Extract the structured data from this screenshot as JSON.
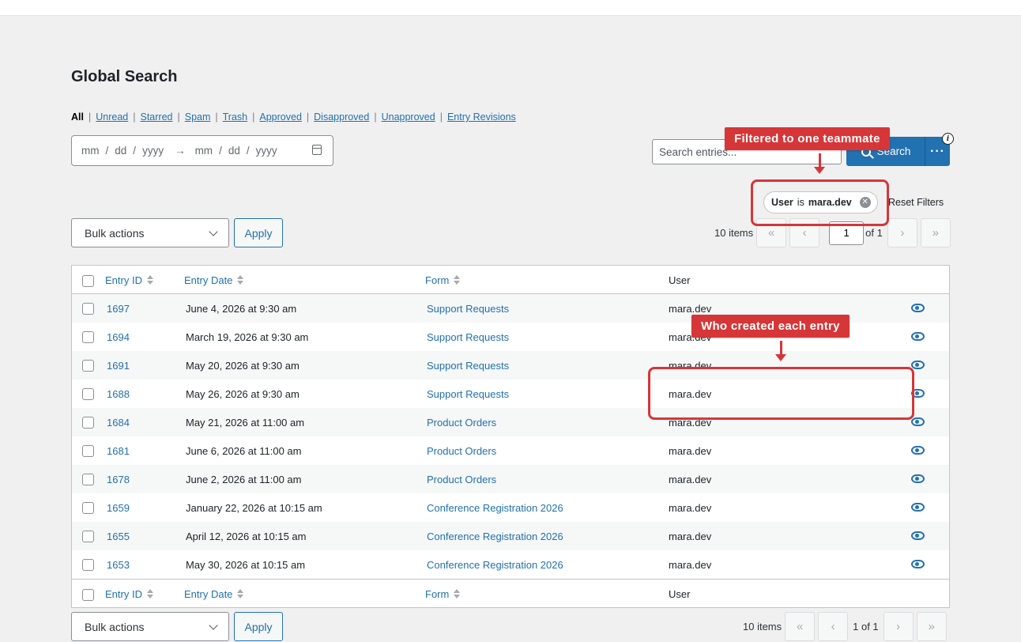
{
  "page": {
    "title": "Global Search"
  },
  "status_links": [
    {
      "label": "All",
      "current": true
    },
    {
      "label": "Unread"
    },
    {
      "label": "Starred"
    },
    {
      "label": "Spam"
    },
    {
      "label": "Trash"
    },
    {
      "label": "Approved"
    },
    {
      "label": "Disapproved"
    },
    {
      "label": "Unapproved"
    },
    {
      "label": "Entry Revisions"
    }
  ],
  "date_range": {
    "start": [
      "mm",
      "dd",
      "yyyy"
    ],
    "end": [
      "mm",
      "dd",
      "yyyy"
    ],
    "separator": "/",
    "arrow": "→"
  },
  "search": {
    "placeholder": "Search entries...",
    "value": "",
    "button_label": "Search",
    "more_label": "···",
    "info_badge": "i"
  },
  "filter_chip": {
    "field": "User",
    "operator": "is",
    "value": "mara.dev",
    "remove": "✕"
  },
  "reset_filters_label": "Reset Filters",
  "bulk_actions": {
    "selected": "Bulk actions",
    "apply_label": "Apply"
  },
  "pagination": {
    "count_text": "10 items",
    "first": "«",
    "prev": "‹",
    "next": "›",
    "last": "»",
    "current_page": "1",
    "of_text": "of 1",
    "bottom_page_text": "1 of 1"
  },
  "table": {
    "columns": [
      "Entry ID",
      "Entry Date",
      "Form",
      "User"
    ],
    "rows": [
      {
        "id": "1697",
        "date": "June 4, 2026 at 9:30 am",
        "form": "Support Requests",
        "user": "mara.dev"
      },
      {
        "id": "1694",
        "date": "March 19, 2026 at 9:30 am",
        "form": "Support Requests",
        "user": "mara.dev"
      },
      {
        "id": "1691",
        "date": "May 20, 2026 at 9:30 am",
        "form": "Support Requests",
        "user": "mara.dev"
      },
      {
        "id": "1688",
        "date": "May 26, 2026 at 9:30 am",
        "form": "Support Requests",
        "user": "mara.dev"
      },
      {
        "id": "1684",
        "date": "May 21, 2026 at 11:00 am",
        "form": "Product Orders",
        "user": "mara.dev"
      },
      {
        "id": "1681",
        "date": "June 6, 2026 at 11:00 am",
        "form": "Product Orders",
        "user": "mara.dev"
      },
      {
        "id": "1678",
        "date": "June 2, 2026 at 11:00 am",
        "form": "Product Orders",
        "user": "mara.dev"
      },
      {
        "id": "1659",
        "date": "January 22, 2026 at 10:15 am",
        "form": "Conference Registration 2026",
        "user": "mara.dev"
      },
      {
        "id": "1655",
        "date": "April 12, 2026 at 10:15 am",
        "form": "Conference Registration 2026",
        "user": "mara.dev"
      },
      {
        "id": "1653",
        "date": "May 30, 2026 at 10:15 am",
        "form": "Conference Registration 2026",
        "user": "mara.dev"
      }
    ]
  },
  "annotations": {
    "filter_callout": "Filtered to one teammate",
    "user_callout": "Who created each entry"
  },
  "colors": {
    "accent": "#2271b1",
    "annotation": "#d63638",
    "background": "#f0f0f1"
  }
}
